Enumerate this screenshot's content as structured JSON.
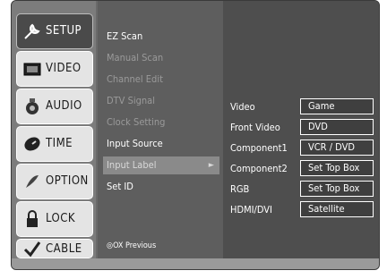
{
  "menu": {
    "items": [
      {
        "label": "SETUP",
        "icon": "wrench-icon",
        "active": true
      },
      {
        "label": "VIDEO",
        "icon": "video-icon",
        "active": false
      },
      {
        "label": "AUDIO",
        "icon": "speaker-icon",
        "active": false
      },
      {
        "label": "TIME",
        "icon": "clock-icon",
        "active": false
      },
      {
        "label": "OPTION",
        "icon": "option-icon",
        "active": false
      },
      {
        "label": "LOCK",
        "icon": "lock-icon",
        "active": false
      },
      {
        "label": "CABLE",
        "icon": "checkmark-icon",
        "active": false
      }
    ]
  },
  "submenu": {
    "items": [
      {
        "label": "EZ Scan",
        "state": "enabled"
      },
      {
        "label": "Manual Scan",
        "state": "disabled"
      },
      {
        "label": "Channel Edit",
        "state": "disabled"
      },
      {
        "label": "DTV Signal",
        "state": "disabled"
      },
      {
        "label": "Clock Setting",
        "state": "disabled"
      },
      {
        "label": "Input Source",
        "state": "enabled"
      },
      {
        "label": "Input Label",
        "state": "selected",
        "arrow": "►"
      },
      {
        "label": "Set ID",
        "state": "enabled"
      },
      {
        "label": "◎OX Previous",
        "state": "enabled"
      }
    ]
  },
  "input_labels": {
    "rows": [
      {
        "source": "Video",
        "label": "Game"
      },
      {
        "source": "Front Video",
        "label": "DVD"
      },
      {
        "source": "Component1",
        "label": "VCR / DVD"
      },
      {
        "source": "Component2",
        "label": "Set Top Box"
      },
      {
        "source": "RGB",
        "label": "Set Top Box"
      },
      {
        "source": "HDMI/DVI",
        "label": "Satellite"
      }
    ]
  }
}
